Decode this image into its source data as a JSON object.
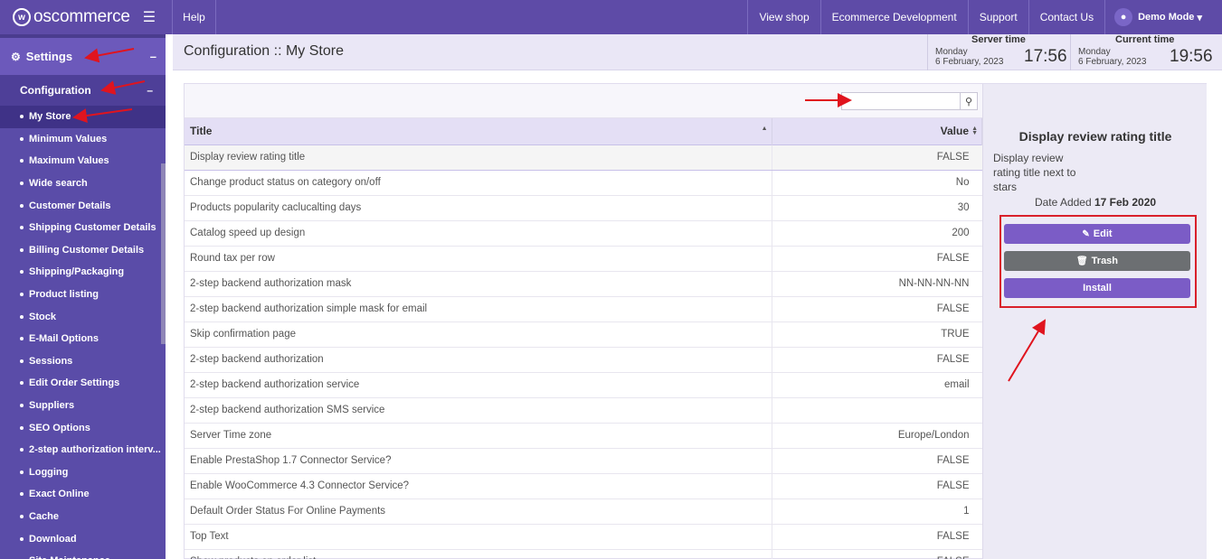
{
  "topbar": {
    "logo": "oscommerce",
    "help": "Help",
    "nav": [
      "View shop",
      "Ecommerce Development",
      "Support",
      "Contact Us"
    ],
    "user": "Demo Mode"
  },
  "sidebar": {
    "settings": "Settings",
    "configuration": "Configuration",
    "items": [
      "My Store",
      "Minimum Values",
      "Maximum Values",
      "Wide search",
      "Customer Details",
      "Shipping Customer Details",
      "Billing Customer Details",
      "Shipping/Packaging",
      "Product listing",
      "Stock",
      "E-Mail Options",
      "Sessions",
      "Edit Order Settings",
      "Suppliers",
      "SEO Options",
      "2-step authorization interv...",
      "Logging",
      "Exact Online",
      "Cache",
      "Download",
      "Site Maintenance"
    ]
  },
  "header": {
    "title": "Configuration :: My Store",
    "server": {
      "label": "Server time",
      "day": "Monday",
      "date": "6 February, 2023",
      "time": "17:56"
    },
    "current": {
      "label": "Current time",
      "day": "Monday",
      "date": "6 February, 2023",
      "time": "19:56"
    }
  },
  "table": {
    "col_title": "Title",
    "col_value": "Value",
    "rows": [
      [
        "Display review rating title",
        "FALSE"
      ],
      [
        "Change product status on category on/off",
        "No"
      ],
      [
        "Products popularity caclucalting days",
        "30"
      ],
      [
        "Catalog speed up design",
        "200"
      ],
      [
        "Round tax per row",
        "FALSE"
      ],
      [
        "2-step backend authorization mask",
        "NN-NN-NN-NN"
      ],
      [
        "2-step backend authorization simple mask for email",
        "FALSE"
      ],
      [
        "Skip confirmation page",
        "TRUE"
      ],
      [
        "2-step backend authorization",
        "FALSE"
      ],
      [
        "2-step backend authorization service",
        "email"
      ],
      [
        "2-step backend authorization SMS service",
        ""
      ],
      [
        "Server Time zone",
        "Europe/London"
      ],
      [
        "Enable PrestaShop 1.7 Connector Service?",
        "FALSE"
      ],
      [
        "Enable WooCommerce 4.3 Connector Service?",
        "FALSE"
      ],
      [
        "Default Order Status For Online Payments",
        "1"
      ],
      [
        "Top Text",
        "FALSE"
      ],
      [
        "Show products on order list",
        "FALSE"
      ]
    ]
  },
  "info": {
    "title": "Display review rating title",
    "desc": "Display review rating title next to stars",
    "date_label": "Date Added",
    "date_value": "17 Feb 2020",
    "edit": "Edit",
    "trash": "Trash",
    "install": "Install"
  }
}
